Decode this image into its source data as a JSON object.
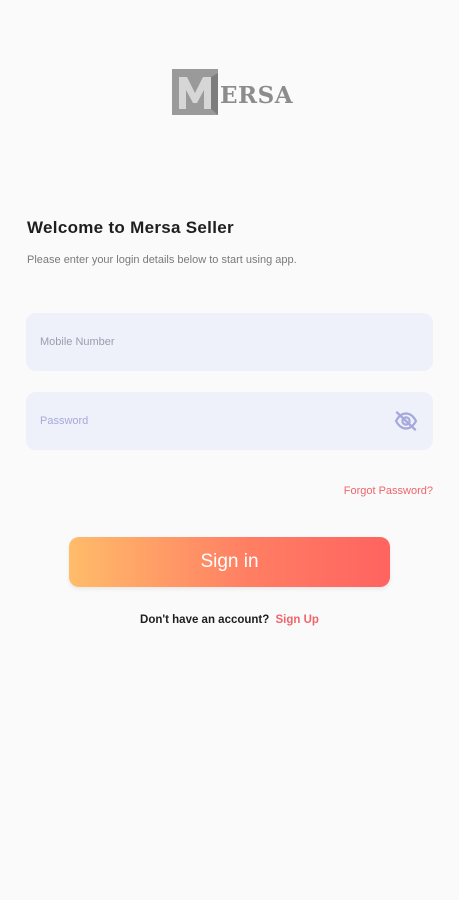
{
  "brand": {
    "logo_text": "ERSA",
    "logo_icon": "mersa-m-logo",
    "logo_color": "#8c8c8c"
  },
  "welcome": {
    "title": "Welcome to Mersa Seller",
    "subtitle": "Please enter your login details below to start using app."
  },
  "form": {
    "mobile": {
      "placeholder": "Mobile Number",
      "value": ""
    },
    "password": {
      "placeholder": "Password",
      "value": "",
      "toggle_icon": "eye-off-icon"
    },
    "forgot_label": "Forgot Password?",
    "signin_label": "Sign in"
  },
  "signup": {
    "prompt": "Don't have an account?",
    "link_label": "Sign Up"
  },
  "colors": {
    "accent": "#f0656b",
    "button_gradient_start": "#ffbc6a",
    "button_gradient_end": "#ff6360",
    "field_background": "#eef0fa",
    "page_background": "#fafafa"
  }
}
